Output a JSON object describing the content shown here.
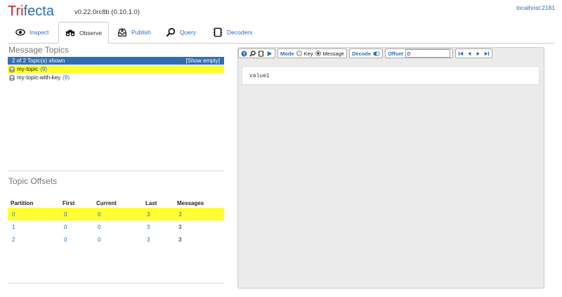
{
  "header": {
    "brand_part1": "Tri",
    "brand_part2": "fecta",
    "version": "v0.22.0rc8b  (0.10.1.0)",
    "host": "localhost:2181"
  },
  "tabs": [
    {
      "label": "Inspect",
      "icon": "eye-icon"
    },
    {
      "label": "Observe",
      "icon": "binoculars-icon",
      "active": true
    },
    {
      "label": "Publish",
      "icon": "inbox-icon"
    },
    {
      "label": "Query",
      "icon": "magnifier-icon"
    },
    {
      "label": "Decoders",
      "icon": "film-icon"
    }
  ],
  "topics": {
    "title": "Message Topics",
    "shown": "2 of 2 Topic(s) shown",
    "show_empty": "[Show empty]",
    "items": [
      {
        "name": "my-topic",
        "count": "(9)",
        "selected": true
      },
      {
        "name": "my-topic-with-key",
        "count": "(9)",
        "selected": false
      }
    ]
  },
  "offsets": {
    "title": "Topic Offsets",
    "columns": [
      "Partition",
      "First",
      "Current",
      "Last",
      "Messages"
    ],
    "rows": [
      [
        "0",
        "0",
        "0",
        "3",
        "3"
      ],
      [
        "1",
        "0",
        "0",
        "3",
        "3"
      ],
      [
        "2",
        "0",
        "0",
        "3",
        "3"
      ]
    ]
  },
  "toolbar": {
    "mode_label": "Mode",
    "mode_key": "Key",
    "mode_message": "Message",
    "decode_label": "Decode",
    "offset_label": "Offset",
    "offset_value": "0"
  },
  "message": {
    "value": "value1"
  },
  "colors": {
    "accent": "#2a6ebb",
    "header_bar": "#2f6fb1",
    "highlight": "#ffff33",
    "brand_red": "#d0202a"
  }
}
